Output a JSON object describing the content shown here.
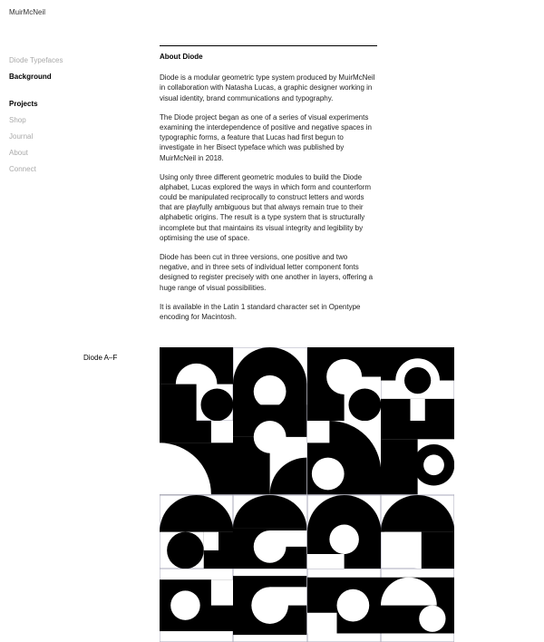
{
  "site_title": "MuirMcNeil",
  "nav": {
    "section": [
      {
        "label": "Diode Typefaces",
        "current": false
      },
      {
        "label": "Background",
        "current": true
      }
    ],
    "projects_heading": "Projects",
    "projects": [
      {
        "label": "Shop"
      },
      {
        "label": "Journal"
      },
      {
        "label": "About"
      },
      {
        "label": "Connect"
      }
    ]
  },
  "article": {
    "title": "About Diode",
    "paragraphs": [
      "Diode is a modular geometric type system produced by MuirMcNeil in collaboration with Natasha Lucas, a graphic designer working in visual identity, brand communications and typography.",
      "The Diode project began as one of a series of visual experiments examining the interdependence of positive and negative spaces in typographic forms, a feature that Lucas had first begun to investigate in her Bisect typeface which was published by MuirMcNeil in 2018.",
      "Using only three different geometric modules to build the Diode alphabet, Lucas explored the ways in which form and counterform could be manipulated reciprocally to construct letters and words that are playfully ambiguous but that always remain true to their alphabetic origins. The result is a type system that is structurally incomplete but that maintains its visual integrity and legibility by optimising the use of space.",
      "Diode has been cut in three versions, one positive and two negative, and in three sets of individual letter component fonts designed to register precisely with one another in layers, offering a huge range of visual possibilities.",
      "It is available in the Latin 1 standard character set in Opentype encoding for Macintosh."
    ]
  },
  "figure_caption": "Diode A–F"
}
